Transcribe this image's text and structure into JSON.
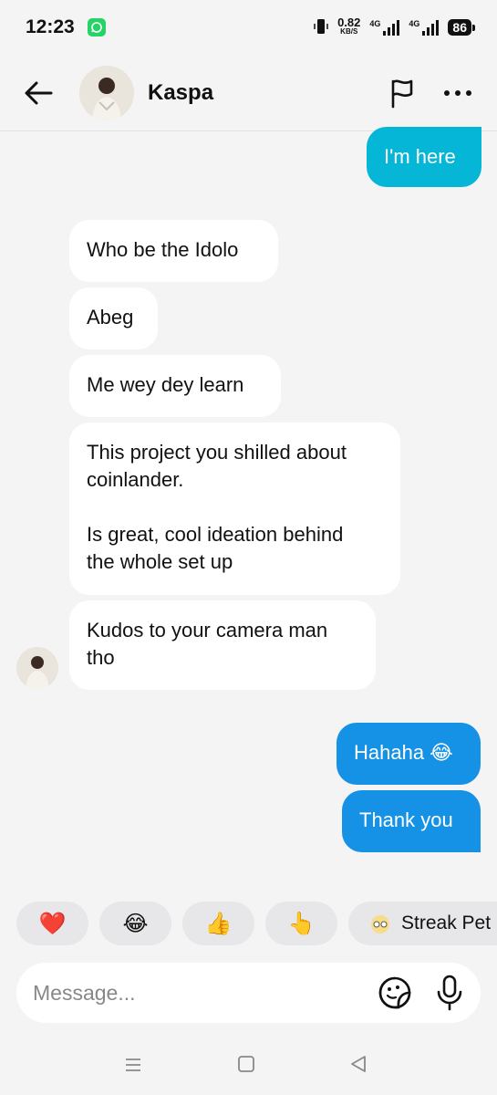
{
  "status_bar": {
    "time": "12:23",
    "speed_value": "0.82",
    "speed_unit": "KB/S",
    "net1": "4G",
    "net2": "4G",
    "battery": "86"
  },
  "header": {
    "contact_name": "Kaspa"
  },
  "messages": {
    "m1": "I'm here",
    "m2": "Who be the Idolo",
    "m3": "Abeg",
    "m4": "Me wey dey learn",
    "m5": "This project you shilled about\ncoinlander.\n\nIs great, cool ideation behind\nthe whole set up",
    "m6": "Kudos to your camera man\ntho",
    "m7": "Hahaha 😂",
    "m8": "Thank you"
  },
  "reactions": {
    "heart": "❤️",
    "laugh": "😂",
    "thumbs": "👍",
    "point": "👆",
    "streak_label": "Streak Pet"
  },
  "composer": {
    "placeholder": "Message..."
  },
  "colors": {
    "outgoing_cyan": "#05b6d6",
    "outgoing_blue": "#1592e6",
    "incoming": "#ffffff",
    "background": "#f4f4f5"
  }
}
